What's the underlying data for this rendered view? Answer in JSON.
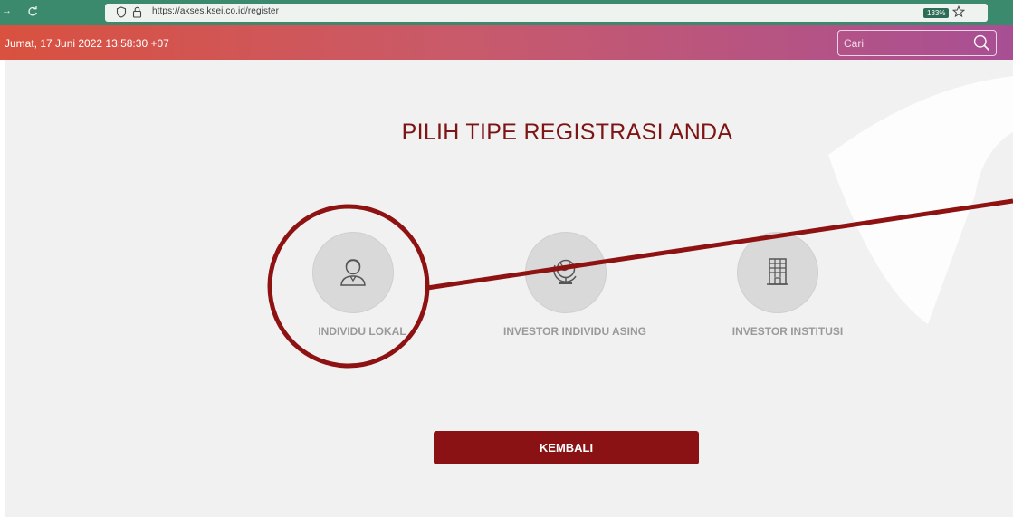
{
  "browser": {
    "url": "https://akses.ksei.co.id/register",
    "zoom": "133%"
  },
  "header": {
    "datetime": "Jumat, 17 Juni 2022 13:58:30 +07",
    "search_placeholder": "Cari"
  },
  "main": {
    "title": "PILIH TIPE REGISTRASI ANDA",
    "options": [
      {
        "label": "INDIVIDU LOKAL",
        "icon": "person-icon"
      },
      {
        "label": "INVESTOR INDIVIDU ASING",
        "icon": "globe-icon"
      },
      {
        "label": "INVESTOR INSTITUSI",
        "icon": "building-icon"
      }
    ],
    "back_label": "KEMBALI"
  },
  "colors": {
    "title": "#7e1515",
    "button": "#8a1214",
    "annotation": "#8e1212",
    "browser_bar": "#3b8a6e"
  }
}
